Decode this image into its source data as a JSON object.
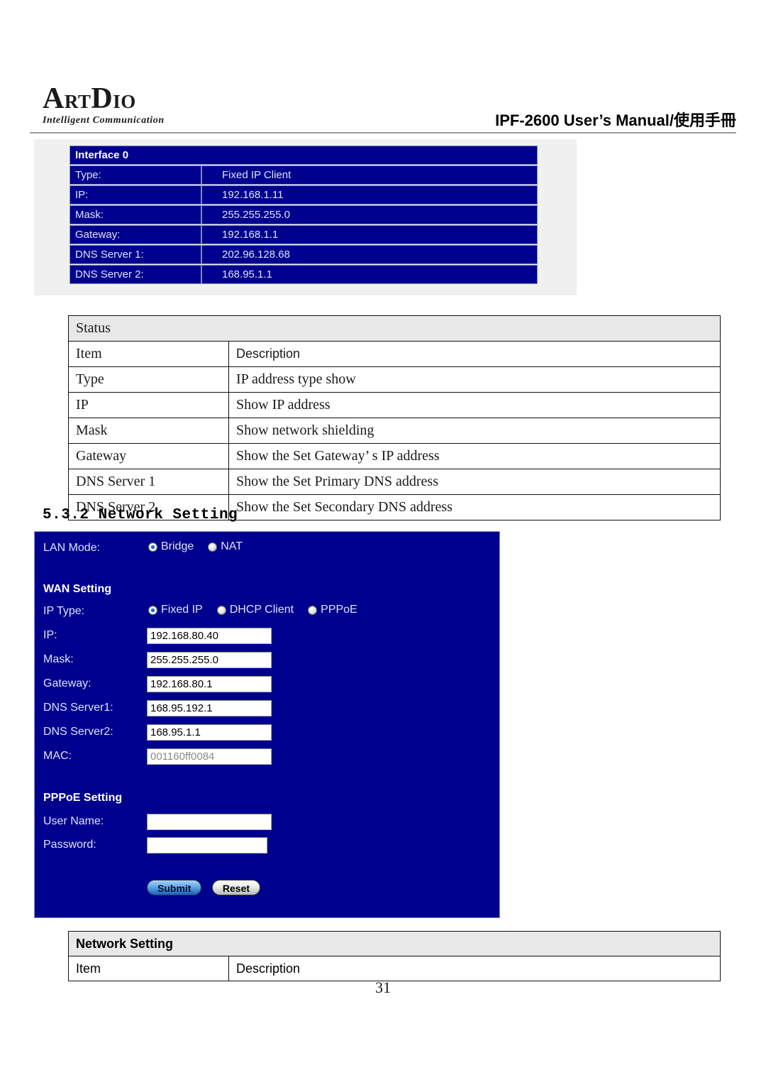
{
  "header": {
    "logo_main": "ARTDIO",
    "logo_part_a": "A",
    "logo_part_rt": "RT",
    "logo_part_d": "D",
    "logo_part_io": "IO",
    "tagline": "Intelligent Communication",
    "manual_title": "IPF-2600 User’s Manual/使用手冊"
  },
  "interface_screenshot": {
    "title": "Interface 0",
    "rows": [
      {
        "label": "Type:",
        "value": "Fixed IP Client"
      },
      {
        "label": "IP:",
        "value": "192.168.1.11"
      },
      {
        "label": "Mask:",
        "value": "255.255.255.0"
      },
      {
        "label": "Gateway:",
        "value": "192.168.1.1"
      },
      {
        "label": "DNS Server 1:",
        "value": "202.96.128.68"
      },
      {
        "label": "DNS Server 2:",
        "value": "168.95.1.1"
      }
    ]
  },
  "status_table": {
    "title": "Status",
    "col_item": "Item",
    "col_description": "Description",
    "rows": [
      {
        "item": "Type",
        "description": "IP address type show"
      },
      {
        "item": "IP",
        "description": "Show IP address"
      },
      {
        "item": "Mask",
        "description": "Show network shielding"
      },
      {
        "item": "Gateway",
        "description": "Show the Set Gateway’ s IP address"
      },
      {
        "item": "DNS Server 1",
        "description": "Show the Set Primary DNS address"
      },
      {
        "item": "DNS Server 2",
        "description": "Show the Set Secondary DNS address"
      }
    ]
  },
  "section": {
    "heading": "5.3.2 Network Setting"
  },
  "network_form": {
    "lan_mode_label": "LAN Mode:",
    "lan_mode_options": [
      {
        "label": "Bridge",
        "selected": true
      },
      {
        "label": "NAT",
        "selected": false
      }
    ],
    "wan_section_title": "WAN Setting",
    "ip_type_label": "IP Type:",
    "ip_type_options": [
      {
        "label": "Fixed IP",
        "selected": true
      },
      {
        "label": "DHCP Client",
        "selected": false
      },
      {
        "label": "PPPoE",
        "selected": false
      }
    ],
    "fields": [
      {
        "label": "IP:",
        "value": "192.168.80.40",
        "disabled": false
      },
      {
        "label": "Mask:",
        "value": "255.255.255.0",
        "disabled": false
      },
      {
        "label": "Gateway:",
        "value": "192.168.80.1",
        "disabled": false
      },
      {
        "label": "DNS Server1:",
        "value": "168.95.192.1",
        "disabled": false
      },
      {
        "label": "DNS Server2:",
        "value": "168.95.1.1",
        "disabled": false
      },
      {
        "label": "MAC:",
        "value": "001160ff0084",
        "disabled": true
      }
    ],
    "pppoe_section_title": "PPPoE Setting",
    "pppoe_fields": [
      {
        "label": "User Name:",
        "value": ""
      },
      {
        "label": "Password:",
        "value": ""
      }
    ],
    "submit_label": "Submit",
    "reset_label": "Reset",
    "colors": {
      "panel_bg": "#00008f",
      "accent_button": "#1a5fc0"
    }
  },
  "network_setting_table": {
    "title": "Network Setting",
    "col_item": "Item",
    "col_description": "Description"
  },
  "footer": {
    "page_number": "31"
  }
}
